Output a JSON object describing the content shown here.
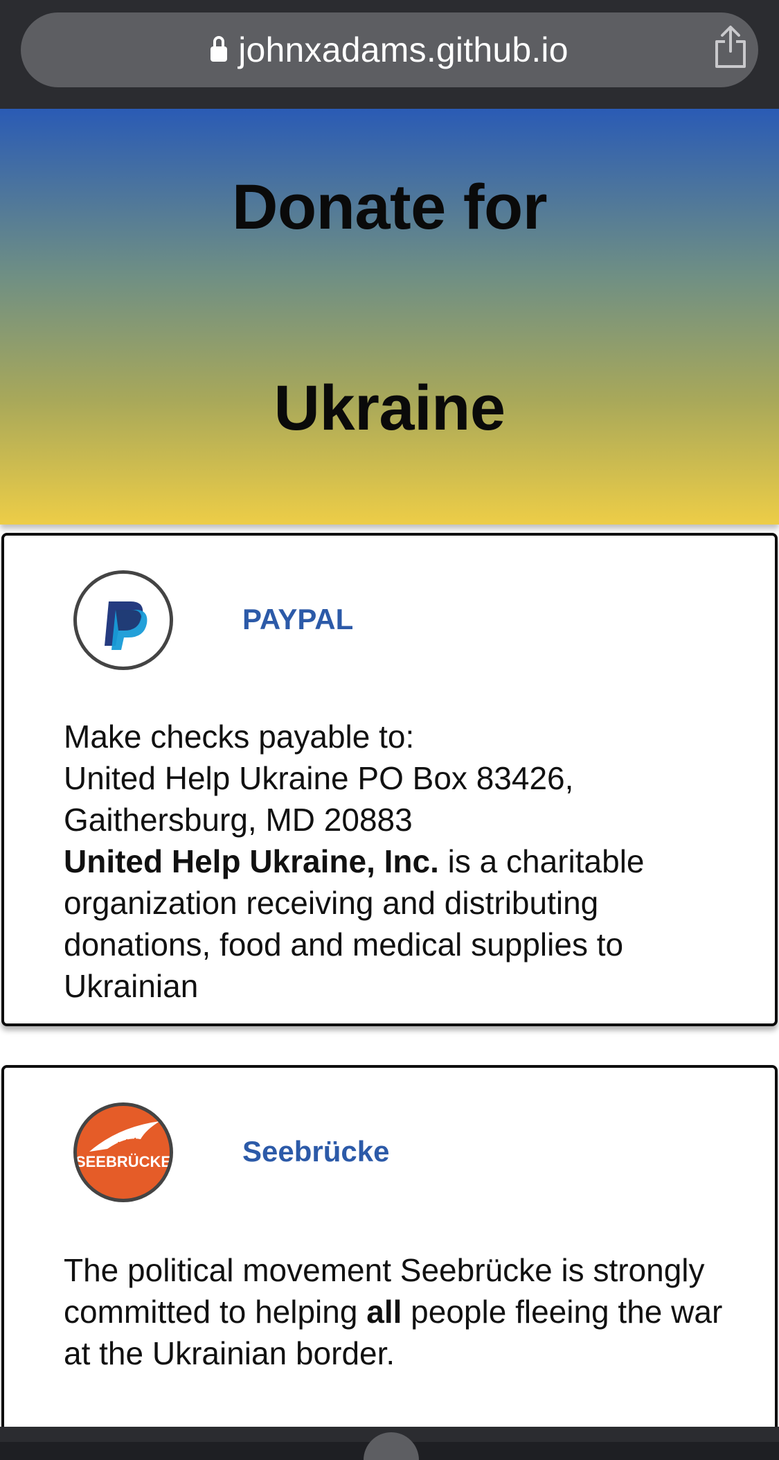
{
  "browser": {
    "url": "johnxadams.github.io"
  },
  "hero": {
    "title_line1": "Donate for",
    "title_line2": "Ukraine"
  },
  "cards": [
    {
      "logo_text": "",
      "title": "PAYPAL",
      "body_line1": "Make checks payable to:",
      "body_line2": "United Help Ukraine PO Box 83426,",
      "body_line3": "Gaithersburg, MD 20883",
      "body_strong": "United Help Ukraine, Inc.",
      "body_rest": " is a charitable organization receiving and distributing donations, food and medical supplies to Ukrainian"
    },
    {
      "logo_text": "SEEBRÜCKE",
      "title": "Seebrücke",
      "body_part1": "The political movement Seebrücke is strongly committed to helping ",
      "body_strong": "all",
      "body_part2": " people fleeing the war at the Ukrainian border."
    }
  ],
  "colors": {
    "gradient_top": "#2a5bb5",
    "gradient_bottom": "#edcd47",
    "title_blue": "#2c5aa8",
    "seebruecke_orange": "#e55c28",
    "paypal_dark": "#253b80",
    "paypal_light": "#179bd7"
  },
  "icons": {
    "lock": "lock-icon",
    "share": "share-icon"
  }
}
